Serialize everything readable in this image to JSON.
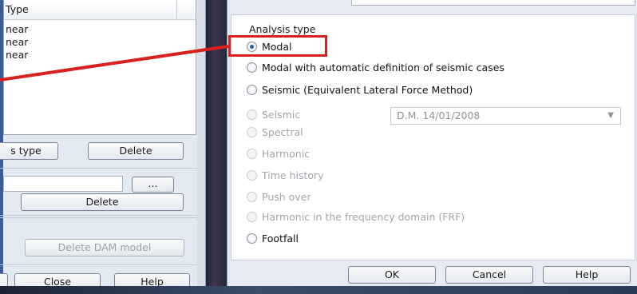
{
  "left_dialog": {
    "list": {
      "header": "Type",
      "rows": [
        "near",
        "near",
        "near"
      ]
    },
    "buttons": {
      "analysis_type": "s type",
      "delete_1": "Delete",
      "browse": "...",
      "delete_2": "Delete",
      "delete_dam": "Delete DAM model",
      "close": "Close",
      "help": "Help"
    }
  },
  "right_dialog": {
    "section_title": "Analysis type",
    "options": {
      "modal": "Modal",
      "modal_auto": "Modal with automatic definition of seismic cases",
      "seismic_elf": "Seismic (Equivalent Lateral Force Method)",
      "seismic": "Seismic",
      "spectral": "Spectral",
      "harmonic": "Harmonic",
      "time_history": "Time history",
      "push_over": "Push over",
      "harmonic_frf": "Harmonic in the frequency domain (FRF)",
      "footfall": "Footfall"
    },
    "selected_option": "Modal",
    "code_select_value": "D.M. 14/01/2008",
    "buttons": {
      "ok": "OK",
      "cancel": "Cancel",
      "help": "Help"
    }
  },
  "colors": {
    "highlight": "#d8201c",
    "radio_checked": "#1f5fb4",
    "disabled_text": "#a0a5ac"
  }
}
